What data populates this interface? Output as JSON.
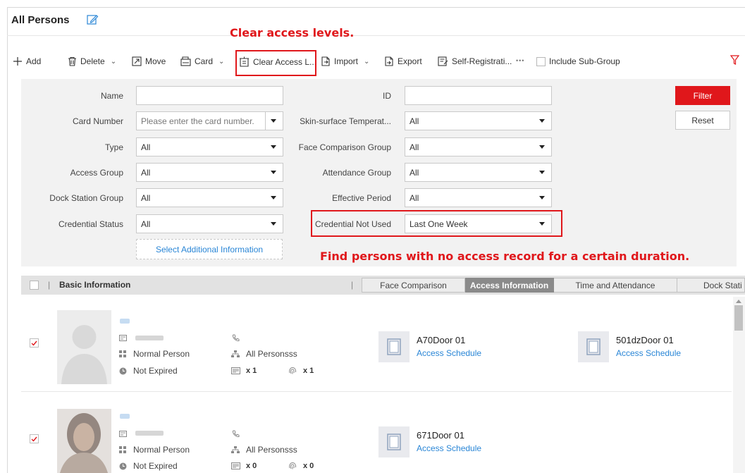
{
  "header": {
    "title": "All Persons",
    "edit_icon": "edit-icon"
  },
  "annotations": {
    "top": "Clear access levels.",
    "middle": "Find persons with no access record for a certain duration."
  },
  "toolbar": {
    "add": "Add",
    "delete": "Delete",
    "move": "Move",
    "card": "Card",
    "clear_access": "Clear Access L...",
    "import": "Import",
    "export": "Export",
    "self_registration": "Self-Registrati...",
    "more": "•••",
    "include_sub_group": "Include Sub-Group"
  },
  "filter": {
    "name_label": "Name",
    "name_value": "",
    "id_label": "ID",
    "id_value": "",
    "card_number_label": "Card Number",
    "card_number_placeholder": "Please enter the card number.",
    "skin_temp_label": "Skin-surface Temperat...",
    "skin_temp_value": "All",
    "type_label": "Type",
    "type_value": "All",
    "face_group_label": "Face Comparison Group",
    "face_group_value": "All",
    "access_group_label": "Access Group",
    "access_group_value": "All",
    "attendance_group_label": "Attendance Group",
    "attendance_group_value": "All",
    "dock_group_label": "Dock Station Group",
    "dock_group_value": "All",
    "effective_period_label": "Effective Period",
    "effective_period_value": "All",
    "credential_status_label": "Credential Status",
    "credential_status_value": "All",
    "credential_not_used_label": "Credential Not Used",
    "credential_not_used_value": "Last One Week",
    "select_additional": "Select Additional Information",
    "filter_button": "Filter",
    "reset_button": "Reset"
  },
  "table": {
    "basic_info": "Basic Information",
    "tabs": [
      {
        "label": "Face Comparison",
        "active": false
      },
      {
        "label": "Access Information",
        "active": true
      },
      {
        "label": "Time and Attendance",
        "active": false
      },
      {
        "label": "Dock Stati",
        "active": false
      }
    ]
  },
  "persons": [
    {
      "checked": true,
      "type": "Normal Person",
      "group": "All Personsss",
      "status": "Not Expired",
      "card_count": "x 1",
      "fingerprint_count": "x 1",
      "doors": [
        {
          "name": "A70Door 01",
          "schedule": "Access Schedule"
        },
        {
          "name": "501dzDoor 01",
          "schedule": "Access Schedule"
        }
      ]
    },
    {
      "checked": true,
      "type": "Normal Person",
      "group": "All Personsss",
      "status": "Not Expired",
      "card_count": "x 0",
      "fingerprint_count": "x 0",
      "doors": [
        {
          "name": "671Door 01",
          "schedule": "Access Schedule"
        }
      ]
    }
  ],
  "colors": {
    "accent_red": "#e0171b",
    "link_blue": "#2a86d6",
    "active_tab": "#8a8a8a"
  }
}
